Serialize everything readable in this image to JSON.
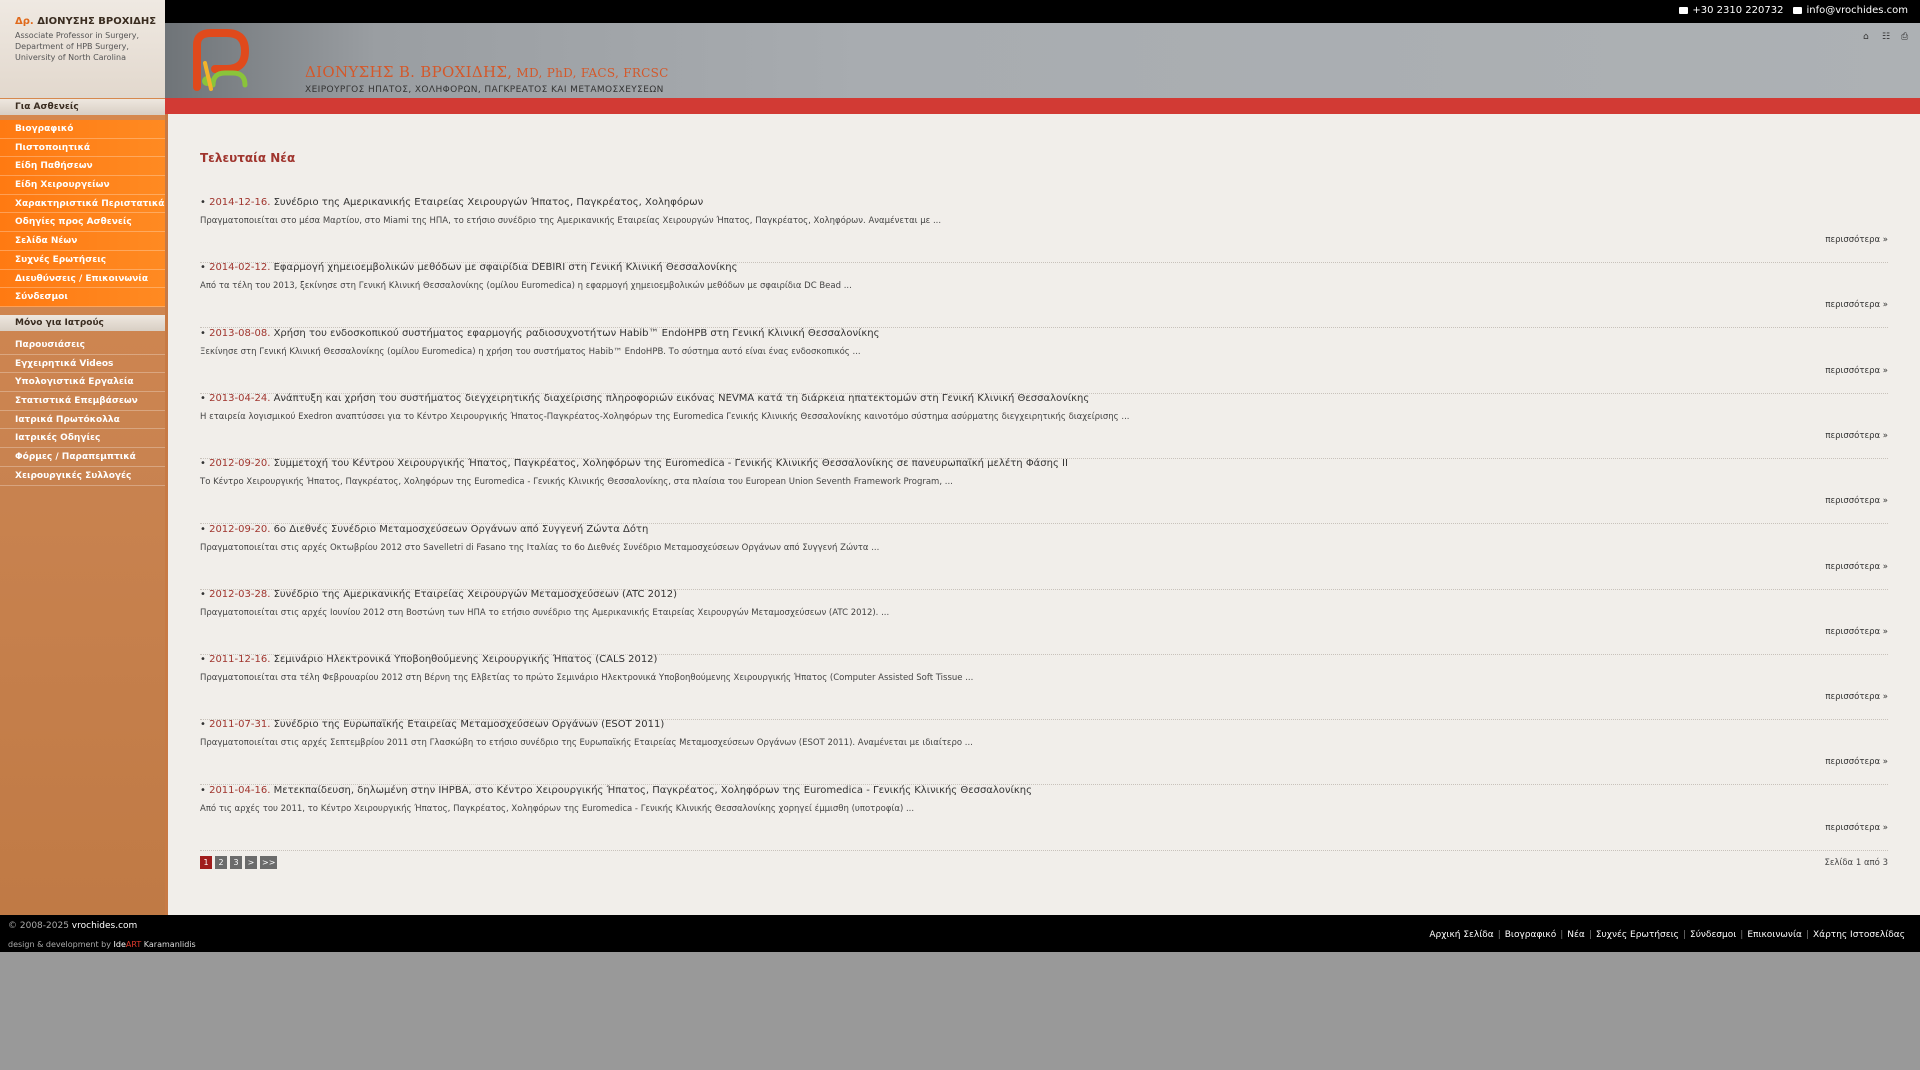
{
  "topbar": {
    "phone": "+30 2310 220732",
    "email": "info@vrochides.com"
  },
  "header": {
    "title_main": "ΔΙΟΝΥΣΗΣ Β. ΒΡΟΧΙΔΗΣ,",
    "title_degrees": " MD, PhD, FACS, FRCSC",
    "subtitle": "ΧΕΙΡΟΥΡΓΟΣ ΗΠΑΤΟΣ, ΧΟΛΗΦΟΡΩΝ, ΠΑΓΚΡΕΑΤΟΣ ΚΑΙ ΜΕΤΑΜΟΣΧΕΥΣΕΩΝ",
    "icons": [
      "home-icon",
      "sitemap-icon",
      "print-icon"
    ]
  },
  "sidebar": {
    "prefix": "Δρ.",
    "name": "ΔΙΟΝΥΣΗΣ ΒΡΟΧΙΔΗΣ",
    "info": [
      "Associate Professor in Surgery,",
      "Department of HPB Surgery,",
      "University of North Carolina"
    ],
    "section1": "Για Ασθενείς",
    "menu1": [
      "Βιογραφικό",
      "Πιστοποιητικά",
      "Είδη Παθήσεων",
      "Είδη Χειρουργείων",
      "Χαρακτηριστικά Περιστατικά",
      "Οδηγίες προς Ασθενείς",
      "Σελίδα Νέων",
      "Συχνές Ερωτήσεις",
      "Διευθύνσεις / Επικοινωνία",
      "Σύνδεσμοι"
    ],
    "section2": "Μόνο για Ιατρούς",
    "menu2": [
      "Παρουσιάσεις",
      "Εγχειρητικά Videos",
      "Υπολογιστικά Εργαλεία",
      "Στατιστικά Επεμβάσεων",
      "Ιατρικά Πρωτόκολλα",
      "Ιατρικές Οδηγίες",
      "Φόρμες / Παραπεμπτικά",
      "Χειρουργικές Συλλογές"
    ]
  },
  "main": {
    "title": "Τελευταία Νέα",
    "more_label": "περισσότερα »",
    "news": [
      {
        "date": "2014-12-16.",
        "title": "Συνέδριο της Αμερικανικής Εταιρείας Χειρουργών Ήπατος, Παγκρέατος, Χοληφόρων",
        "excerpt": "Πραγματοποιείται στο μέσα Μαρτίου, στο Miami της ΗΠΑ, το ετήσιο συνέδριο της Αμερικανικής Εταιρείας Χειρουργών Ήπατος, Παγκρέατος, Χοληφόρων. Αναμένεται με ..."
      },
      {
        "date": "2014-02-12.",
        "title": "Εφαρμογή χημειοεμβολικών μεθόδων με σφαιρίδια DEBIRI στη Γενική Κλινική Θεσσαλονίκης",
        "excerpt": "Από τα τέλη του 2013, ξεκίνησε στη Γενική Κλινική Θεσσαλονίκης (ομίλου Euromedica) η εφαρμογή χημειοεμβολικών μεθόδων με σφαιρίδια DC Bead ..."
      },
      {
        "date": "2013-08-08.",
        "title": "Χρήση του ενδοσκοπικού συστήματος εφαρμογής ραδιοσυχνοτήτων Habib™ EndoHPB στη Γενική Κλινική Θεσσαλονίκης",
        "excerpt": "Ξεκίνησε στη Γενική Κλινική Θεσσαλονίκης (ομίλου Euromedica) η χρήση του συστήματος Habib™ EndoHPB. Το σύστημα αυτό είναι ένας ενδοσκοπικός ..."
      },
      {
        "date": "2013-04-24.",
        "title": "Ανάπτυξη και χρήση του συστήματος διεγχειρητικής διαχείρισης πληροφοριών εικόνας NEVMA κατά τη διάρκεια ηπατεκτομών στη Γενική Κλινική Θεσσαλονίκης",
        "excerpt": "Η εταιρεία λογισμικού Exedron αναπτύσσει για το Κέντρο Χειρουργικής Ήπατος-Παγκρέατος-Χοληφόρων της Euromedica Γενικής Κλινικής Θεσσαλονίκης καινοτόμο σύστημα ασύρματης διεγχειρητικής διαχείρισης ..."
      },
      {
        "date": "2012-09-20.",
        "title": "Συμμετοχή του Κέντρου Χειρουργικής Ήπατος, Παγκρέατος, Χοληφόρων της Euromedica - Γενικής Κλινικής Θεσσαλονίκης σε πανευρωπαϊκή μελέτη Φάσης ΙΙ",
        "excerpt": "Το Κέντρο Χειρουργικής Ήπατος, Παγκρέατος, Χοληφόρων της Euromedica - Γενικής Κλινικής Θεσσαλονίκης, στα πλαίσια του European Union Seventh Framework Program, ..."
      },
      {
        "date": "2012-09-20.",
        "title": "6ο Διεθνές Συνέδριο Μεταμοσχεύσεων Οργάνων από Συγγενή Ζώντα Δότη",
        "excerpt": "Πραγματοποιείται στις αρχές Οκτωβρίου 2012 στο Savelletri di Fasano της Ιταλίας το 6ο Διεθνές Συνέδριο Μεταμοσχεύσεων Οργάνων από Συγγενή Ζώντα ..."
      },
      {
        "date": "2012-03-28.",
        "title": "Συνέδριο της Αμερικανικής Εταιρείας Χειρουργών Μεταμοσχεύσεων (ATC 2012)",
        "excerpt": "Πραγματοποιείται στις αρχές Ιουνίου 2012 στη Βοστώνη των ΗΠΑ το ετήσιο συνέδριο της Αμερικανικής Εταιρείας Χειρουργών Μεταμοσχεύσεων (ATC 2012). ..."
      },
      {
        "date": "2011-12-16.",
        "title": "Σεμινάριο Ηλεκτρονικά Υποβοηθούμενης Χειρουργικής Ήπατος (CALS 2012)",
        "excerpt": "Πραγματοποιείται στα τέλη Φεβρουαρίου 2012 στη Βέρνη της Ελβετίας το πρώτο Σεμινάριο Ηλεκτρονικά Υποβοηθούμενης Χειρουργικής Ήπατος (Computer Assisted Soft Tissue ..."
      },
      {
        "date": "2011-07-31.",
        "title": "Συνέδριο της Ευρωπαϊκής Εταιρείας Μεταμοσχεύσεων Οργάνων (ESOT 2011)",
        "excerpt": "Πραγματοποιείται στις αρχές Σεπτεμβρίου 2011 στη Γλασκώβη το ετήσιο συνέδριο της Ευρωπαϊκής Εταιρείας Μεταμοσχεύσεων Οργάνων (ESOT 2011). Αναμένεται με ιδιαίτερο ..."
      },
      {
        "date": "2011-04-16.",
        "title": "Μετεκπαίδευση, δηλωμένη στην IHPBA, στο Κέντρο Χειρουργικής Ήπατος, Παγκρέατος, Χοληφόρων της Euromedica - Γενικής Κλινικής Θεσσαλονίκης",
        "excerpt": "Από τις αρχές του 2011, το Κέντρο Χειρουργικής Ήπατος, Παγκρέατος, Χοληφόρων της Euromedica - Γενικής Κλινικής Θεσσαλονίκης χορηγεί έμμισθη (υποτροφία) ..."
      }
    ],
    "pager": [
      "1",
      "2",
      "3",
      ">",
      ">>"
    ],
    "page_count": "Σελίδα 1 από 3"
  },
  "footer": {
    "copyright": "© 2008-2025",
    "site": "vrochides.com",
    "credit_prefix": "design & development by",
    "credit_ide": "Ide",
    "credit_art": "ART",
    "credit_name": "Karamanlidis",
    "nav": [
      "Αρχική Σελίδα",
      "Βιογραφικό",
      "Νέα",
      "Συχνές Ερωτήσεις",
      "Σύνδεσμοι",
      "Επικοινωνία",
      "Χάρτης Ιστοσελίδας"
    ]
  },
  "colors": {
    "accent_red": "#d23a34",
    "menu_orange": "#ff7a12",
    "date_red": "#a0352e"
  }
}
